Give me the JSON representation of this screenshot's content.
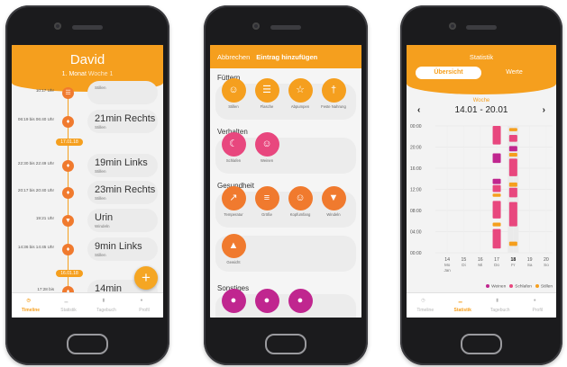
{
  "colors": {
    "orange": "#f59f1e",
    "dot_orange": "#f07a2e",
    "weinen": "#c0268f",
    "schlafen": "#e8477e",
    "stillen": "#f59f1e",
    "card_bg": "#ebebeb"
  },
  "phone1": {
    "header": {
      "name": "David",
      "month_number": "1.",
      "month_label": "Monat",
      "week_label": "Woche 1"
    },
    "entries": [
      {
        "time": "10:17 Uhr",
        "title": "",
        "sub": "Stillen",
        "icon": "bottle-icon"
      },
      {
        "time": "06:19 bis 06:40 Uhr",
        "title": "21min Rechts",
        "sub": "Stillen",
        "icon": "drop-icon"
      },
      {
        "time": "22:30 bis 22:49 Uhr",
        "title": "19min Links",
        "sub": "Stillen",
        "icon": "drop-icon"
      },
      {
        "time": "20:17 bis 20:40 Uhr",
        "title": "23min Rechts",
        "sub": "Stillen",
        "icon": "drop-icon"
      },
      {
        "time": "19:21 Uhr",
        "title": "Urin",
        "sub": "Windeln",
        "icon": "diaper-icon"
      },
      {
        "time": "14:36 bis 14:45 Uhr",
        "title": "9min Links",
        "sub": "Stillen",
        "icon": "drop-icon"
      },
      {
        "time": "17:28 bis",
        "title": "14min",
        "sub": "",
        "icon": "drop-icon"
      }
    ],
    "date_pills": [
      "17.01.18",
      "16.01.18"
    ],
    "fab_label": "+",
    "tabs": [
      "Timeline",
      "Statistik",
      "Tagebuch",
      "Profil"
    ]
  },
  "phone2": {
    "header": {
      "cancel": "Abbrechen",
      "title": "Eintrag hinzufügen"
    },
    "sections": [
      {
        "title": "Füttern",
        "items": [
          {
            "label": "Stillen",
            "icon": "baby-icon",
            "tone": "orange"
          },
          {
            "label": "Flasche",
            "icon": "bottle-icon",
            "tone": "orange"
          },
          {
            "label": "Abpumpen",
            "icon": "pump-icon",
            "tone": "orange"
          },
          {
            "label": "Feste Nahrung",
            "icon": "cutlery-icon",
            "tone": "orange"
          }
        ]
      },
      {
        "title": "Verhalten",
        "items": [
          {
            "label": "Schlafen",
            "icon": "moon-icon",
            "tone": "pink"
          },
          {
            "label": "Weinen",
            "icon": "crying-face-icon",
            "tone": "pink"
          }
        ]
      },
      {
        "title": "Gesundheit",
        "items": [
          {
            "label": "Temperatur",
            "icon": "thermometer-icon",
            "tone": "red"
          },
          {
            "label": "Größe",
            "icon": "ruler-icon",
            "tone": "red"
          },
          {
            "label": "Kopfumfang",
            "icon": "head-icon",
            "tone": "red"
          },
          {
            "label": "Windeln",
            "icon": "diaper-icon",
            "tone": "red"
          }
        ]
      },
      {
        "title": "",
        "items": [
          {
            "label": "Gewicht",
            "icon": "weight-icon",
            "tone": "red"
          }
        ]
      },
      {
        "title": "Sonstiges",
        "items": [
          {
            "label": "",
            "icon": "misc-icon",
            "tone": "magenta"
          },
          {
            "label": "",
            "icon": "misc-icon",
            "tone": "magenta"
          },
          {
            "label": "",
            "icon": "misc-icon",
            "tone": "magenta"
          }
        ]
      }
    ]
  },
  "phone3": {
    "header": {
      "title": "Statistik",
      "seg_active": "Übersicht",
      "seg_other": "Werte"
    },
    "week_label": "Woche",
    "week_range": "14.01 - 20.01",
    "arrow_left": "‹",
    "arrow_right": "›",
    "tabs": [
      "Timeline",
      "Statistik",
      "Tagebuch",
      "Profil"
    ]
  },
  "chart_data": {
    "type": "bar",
    "title": "",
    "ylabel": "",
    "xlabel": "",
    "y_ticks": [
      "00:00",
      "20:00",
      "16:00",
      "12:00",
      "08:00",
      "04:00",
      "00:00"
    ],
    "ylim": [
      0,
      24
    ],
    "categories": [
      {
        "day": "14",
        "wd": "Mo",
        "month": "Jan"
      },
      {
        "day": "15",
        "wd": "Di",
        "month": ""
      },
      {
        "day": "16",
        "wd": "Mi",
        "month": ""
      },
      {
        "day": "17",
        "wd": "Do",
        "month": ""
      },
      {
        "day": "18",
        "wd": "Fr",
        "month": ""
      },
      {
        "day": "19",
        "wd": "Sa",
        "month": ""
      },
      {
        "day": "20",
        "wd": "So",
        "month": ""
      }
    ],
    "selected_day": "18",
    "legend": [
      "Weinen",
      "Schlafen",
      "Stillen"
    ],
    "segments": [
      {
        "day_index": 3,
        "series": "Schlafen",
        "from": 20.5,
        "to": 24
      },
      {
        "day_index": 3,
        "series": "Weinen",
        "from": 17.0,
        "to": 18.8
      },
      {
        "day_index": 3,
        "series": "Weinen",
        "from": 13.0,
        "to": 14.0
      },
      {
        "day_index": 3,
        "series": "Schlafen",
        "from": 11.5,
        "to": 12.8
      },
      {
        "day_index": 3,
        "series": "Stillen",
        "from": 10.6,
        "to": 11.2
      },
      {
        "day_index": 3,
        "series": "Schlafen",
        "from": 6.5,
        "to": 9.8
      },
      {
        "day_index": 3,
        "series": "Stillen",
        "from": 5.0,
        "to": 5.7
      },
      {
        "day_index": 3,
        "series": "Schlafen",
        "from": 0.8,
        "to": 4.5
      },
      {
        "day_index": 4,
        "series": "Stillen",
        "from": 23.0,
        "to": 23.6
      },
      {
        "day_index": 4,
        "series": "Schlafen",
        "from": 21.0,
        "to": 22.3
      },
      {
        "day_index": 4,
        "series": "Weinen",
        "from": 19.2,
        "to": 20.2
      },
      {
        "day_index": 4,
        "series": "Stillen",
        "from": 18.2,
        "to": 18.9
      },
      {
        "day_index": 4,
        "series": "Schlafen",
        "from": 14.5,
        "to": 17.8
      },
      {
        "day_index": 4,
        "series": "Stillen",
        "from": 12.5,
        "to": 13.3
      },
      {
        "day_index": 4,
        "series": "Schlafen",
        "from": 10.5,
        "to": 12.3
      },
      {
        "day_index": 4,
        "series": "Schlafen",
        "from": 5.0,
        "to": 9.6
      },
      {
        "day_index": 4,
        "series": "Stillen",
        "from": 1.3,
        "to": 2.1
      }
    ]
  }
}
